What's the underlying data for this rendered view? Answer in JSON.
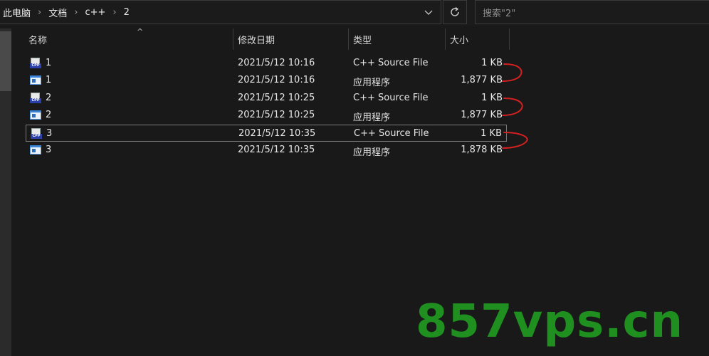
{
  "address_bar": {
    "breadcrumbs": [
      "此电脑",
      "文档",
      "c++",
      "2"
    ],
    "search_placeholder": "搜索\"2\""
  },
  "columns": {
    "name": "名称",
    "date": "修改日期",
    "type": "类型",
    "size": "大小"
  },
  "files": [
    {
      "name": "1",
      "date": "2021/5/12 10:16",
      "type": "C++ Source File",
      "size": "1 KB",
      "icon": "cpp-file-icon"
    },
    {
      "name": "1",
      "date": "2021/5/12 10:16",
      "type": "应用程序",
      "size": "1,877 KB",
      "icon": "exe-app-icon"
    },
    {
      "name": "2",
      "date": "2021/5/12 10:25",
      "type": "C++ Source File",
      "size": "1 KB",
      "icon": "cpp-file-icon"
    },
    {
      "name": "2",
      "date": "2021/5/12 10:25",
      "type": "应用程序",
      "size": "1,877 KB",
      "icon": "exe-app-icon"
    },
    {
      "name": "3",
      "date": "2021/5/12 10:35",
      "type": "C++ Source File",
      "size": "1 KB",
      "icon": "cpp-file-icon"
    },
    {
      "name": "3",
      "date": "2021/5/12 10:35",
      "type": "应用程序",
      "size": "1,878 KB",
      "icon": "exe-app-icon"
    }
  ],
  "selected_row": 4,
  "watermark": "857vps.cn",
  "colors": {
    "background": "#191919",
    "annotation": "#d42020",
    "watermark": "#1f8f1f"
  }
}
